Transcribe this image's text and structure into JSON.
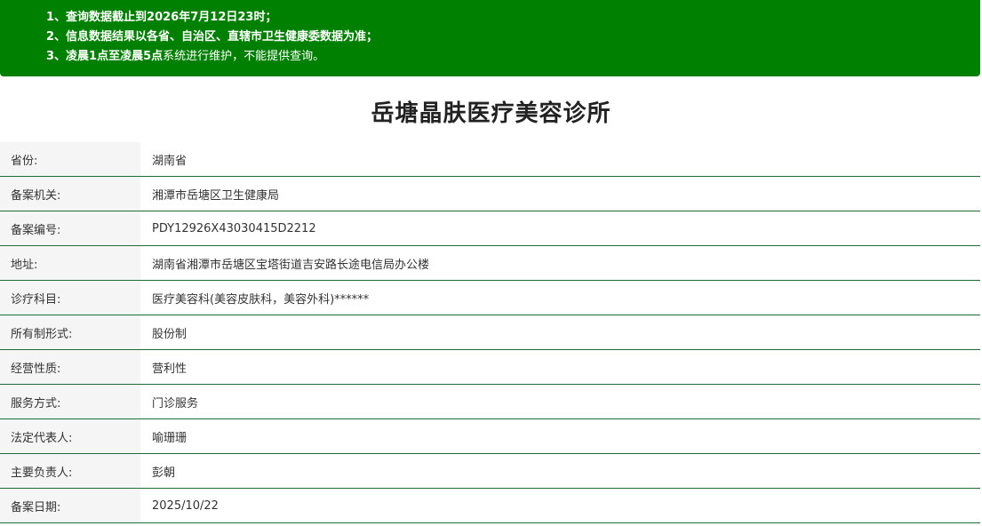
{
  "notice": {
    "line1": "1、查询数据截止到2026年7月12日23时；",
    "line2": "2、信息数据结果以各省、自治区、直辖市卫生健康委数据为准；",
    "line3_prefix": "3、",
    "line3_bold": "凌晨1点至凌晨5点",
    "line3_suffix": "系统进行维护，不能提供查询。"
  },
  "title": "岳塘晶肤医疗美容诊所",
  "rows": [
    {
      "label": "省份:",
      "value": "湖南省"
    },
    {
      "label": "备案机关:",
      "value": "湘潭市岳塘区卫生健康局"
    },
    {
      "label": "备案编号:",
      "value": "PDY12926X43030415D2212"
    },
    {
      "label": "地址:",
      "value": "湖南省湘潭市岳塘区宝塔街道吉安路长途电信局办公楼"
    },
    {
      "label": "诊疗科目:",
      "value": "医疗美容科(美容皮肤科，美容外科)******"
    },
    {
      "label": "所有制形式:",
      "value": "股份制"
    },
    {
      "label": "经营性质:",
      "value": "营利性"
    },
    {
      "label": "服务方式:",
      "value": "门诊服务"
    },
    {
      "label": "法定代表人:",
      "value": "喻珊珊"
    },
    {
      "label": "主要负责人:",
      "value": "彭朝"
    },
    {
      "label": "备案日期:",
      "value": "2025/10/22"
    }
  ],
  "colors": {
    "notice_bg": "#008000",
    "row_border": "#1f6b3c",
    "label_bg": "#f5f5f5"
  }
}
